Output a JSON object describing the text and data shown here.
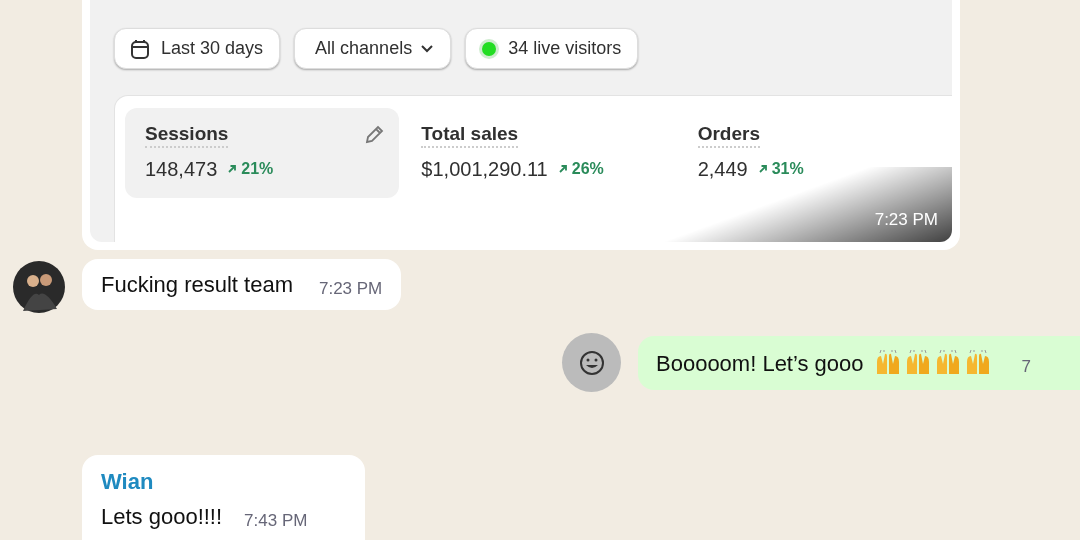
{
  "image_message": {
    "filters": [
      {
        "kind": "date",
        "label": "Last 30 days"
      },
      {
        "kind": "dropdown",
        "label": "All channels"
      },
      {
        "kind": "live",
        "label": "34 live visitors"
      }
    ],
    "metrics": [
      {
        "label": "Sessions",
        "value": "148,473",
        "change": "21%",
        "selected": true
      },
      {
        "label": "Total sales",
        "value": "$1,001,290.11",
        "change": "26%",
        "selected": false
      },
      {
        "label": "Orders",
        "value": "2,449",
        "change": "31%",
        "selected": false
      }
    ],
    "time": "7:23 PM"
  },
  "messages": [
    {
      "kind": "incoming_avatar",
      "text": "Fucking result team",
      "time": "7:23 PM"
    },
    {
      "kind": "outgoing",
      "text": "Booooom! Let’s gooo",
      "emojis": [
        {
          "kind": "raising_hands"
        },
        {
          "kind": "raising_hands"
        },
        {
          "kind": "raising_hands"
        },
        {
          "kind": "raising_hands"
        }
      ],
      "time": "7"
    },
    {
      "kind": "incoming_named",
      "sender": "Wian",
      "text": "Lets gooo!!!!",
      "time": "7:43 PM"
    }
  ]
}
